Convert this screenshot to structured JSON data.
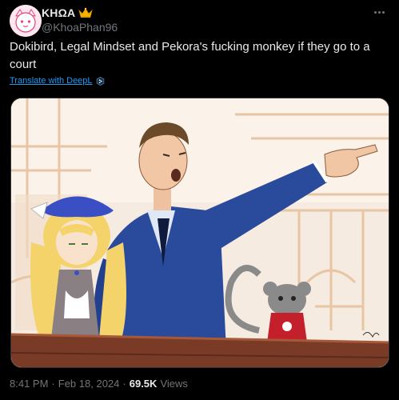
{
  "author": {
    "display_name": "KHΩA",
    "handle": "@KhoaPhan96",
    "badge_icon": "crown-icon",
    "avatar_colors": {
      "bg": "#ffe6ef",
      "face": "#ffffff",
      "accent": "#e9407a"
    }
  },
  "tweet": {
    "text": "Dokibird, Legal Mindset and Pekora's fucking monkey if they go to a court",
    "translate_label": "Translate with DeepL"
  },
  "meta": {
    "time": "8:41 PM",
    "separator1": "·",
    "date": "Feb 18, 2024",
    "separator2": "·",
    "views_count": "69.5K",
    "views_label": "Views"
  },
  "colors": {
    "background": "#000000",
    "text": "#e7e9ea",
    "muted": "#71767b",
    "link": "#1d9bf0",
    "border": "#2f3336",
    "suit_blue": "#2a4a9c",
    "hair_blonde": "#f3d36a",
    "beret_blue": "#3b4fc4",
    "desk_wood": "#7a3b26",
    "monkey_grey": "#8a8a8a",
    "monkey_shirt": "#c4202b"
  }
}
